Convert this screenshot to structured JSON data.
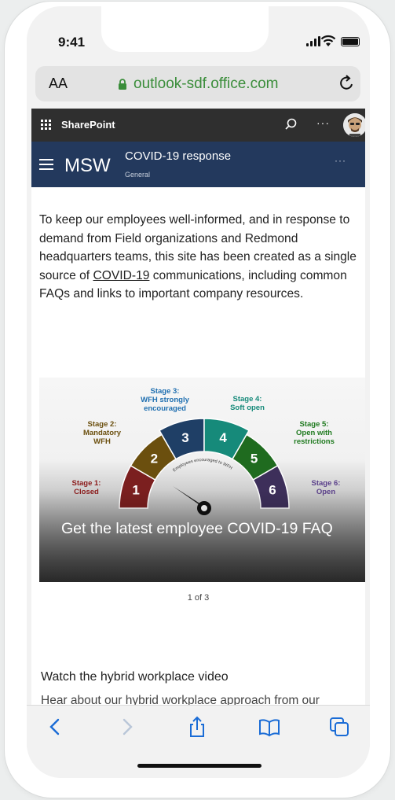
{
  "status_bar": {
    "time": "9:41"
  },
  "browser": {
    "aa_label": "AA",
    "url": "outlook-sdf.office.com"
  },
  "suite_bar": {
    "app_name": "SharePoint",
    "more_label": "···"
  },
  "site_header": {
    "site_name": "MSW",
    "page_title": "COVID-19 response",
    "section": "General",
    "more_label": "···"
  },
  "intro": {
    "text_before": "To keep our employees well-informed, and in response to demand from Field organizations and Redmond headquarters teams, this site has been created as a single source of ",
    "link_text": "COVID-19",
    "text_after": " communications, including common FAQs and links to important company resources."
  },
  "carousel": {
    "caption": "Get the latest employee COVID-19 FAQ",
    "counter": "1 of 3",
    "gauge_pointer_text": "Employees encouraged to WFH",
    "stages": [
      {
        "num": "1",
        "label1": "Stage 1:",
        "label2": "Closed",
        "label3": "",
        "color": "#7b1f1f",
        "label_color": "#8b1a1a"
      },
      {
        "num": "2",
        "label1": "Stage 2:",
        "label2": "Mandatory",
        "label3": "WFH",
        "color": "#6b4f0e",
        "label_color": "#6b4f0e"
      },
      {
        "num": "3",
        "label1": "Stage 3:",
        "label2": "WFH strongly",
        "label3": "encouraged",
        "color": "#1f3f66",
        "label_color": "#1f6fb0"
      },
      {
        "num": "4",
        "label1": "Stage 4:",
        "label2": "Soft open",
        "label3": "",
        "color": "#168a7a",
        "label_color": "#168a7a"
      },
      {
        "num": "5",
        "label1": "Stage 5:",
        "label2": "Open with",
        "label3": "restrictions",
        "color": "#1f6b1f",
        "label_color": "#1f7a1f"
      },
      {
        "num": "6",
        "label1": "Stage 6:",
        "label2": "Open",
        "label3": "",
        "color": "#3d2f5a",
        "label_color": "#5a3f8a"
      }
    ]
  },
  "section": {
    "title": "Watch the hybrid workplace video",
    "body": "Hear about our hybrid workplace approach from our"
  }
}
